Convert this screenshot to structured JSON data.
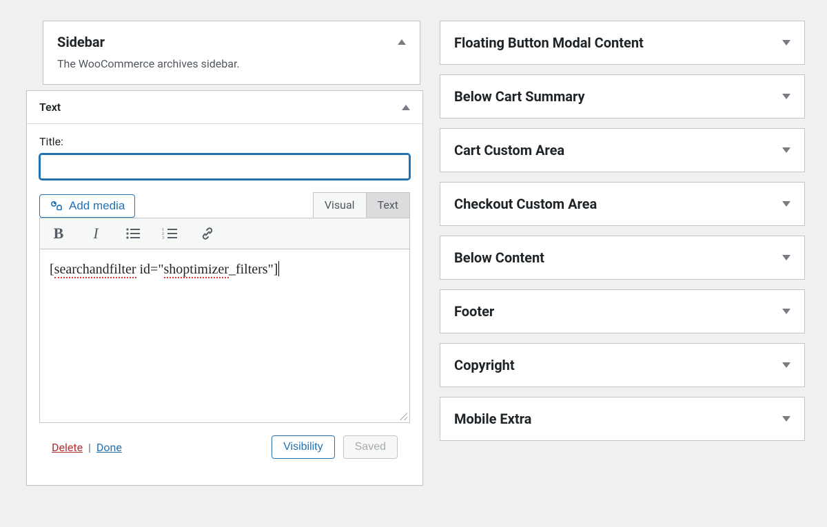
{
  "left": {
    "sidebar": {
      "title": "Sidebar",
      "description": "The WooCommerce archives sidebar."
    },
    "widget": {
      "name": "Text",
      "title_label": "Title:",
      "title_value": "",
      "add_media_label": "Add media",
      "tabs": {
        "visual": "Visual",
        "text": "Text"
      },
      "editor_content": "[searchandfilter id=\"shoptimizer_filters\"]",
      "editor_parts": {
        "pre": "[",
        "word1": "searchandfilter",
        "mid": " id=\"",
        "word2": "shoptimizer",
        "post": "_filters\"]"
      },
      "footer": {
        "delete": "Delete",
        "separator": "|",
        "done": "Done",
        "visibility": "Visibility",
        "saved": "Saved"
      }
    }
  },
  "right": {
    "areas": [
      {
        "title": "Floating Button Modal Content"
      },
      {
        "title": "Below Cart Summary"
      },
      {
        "title": "Cart Custom Area"
      },
      {
        "title": "Checkout Custom Area"
      },
      {
        "title": "Below Content"
      },
      {
        "title": "Footer"
      },
      {
        "title": "Copyright"
      },
      {
        "title": "Mobile Extra"
      }
    ]
  }
}
